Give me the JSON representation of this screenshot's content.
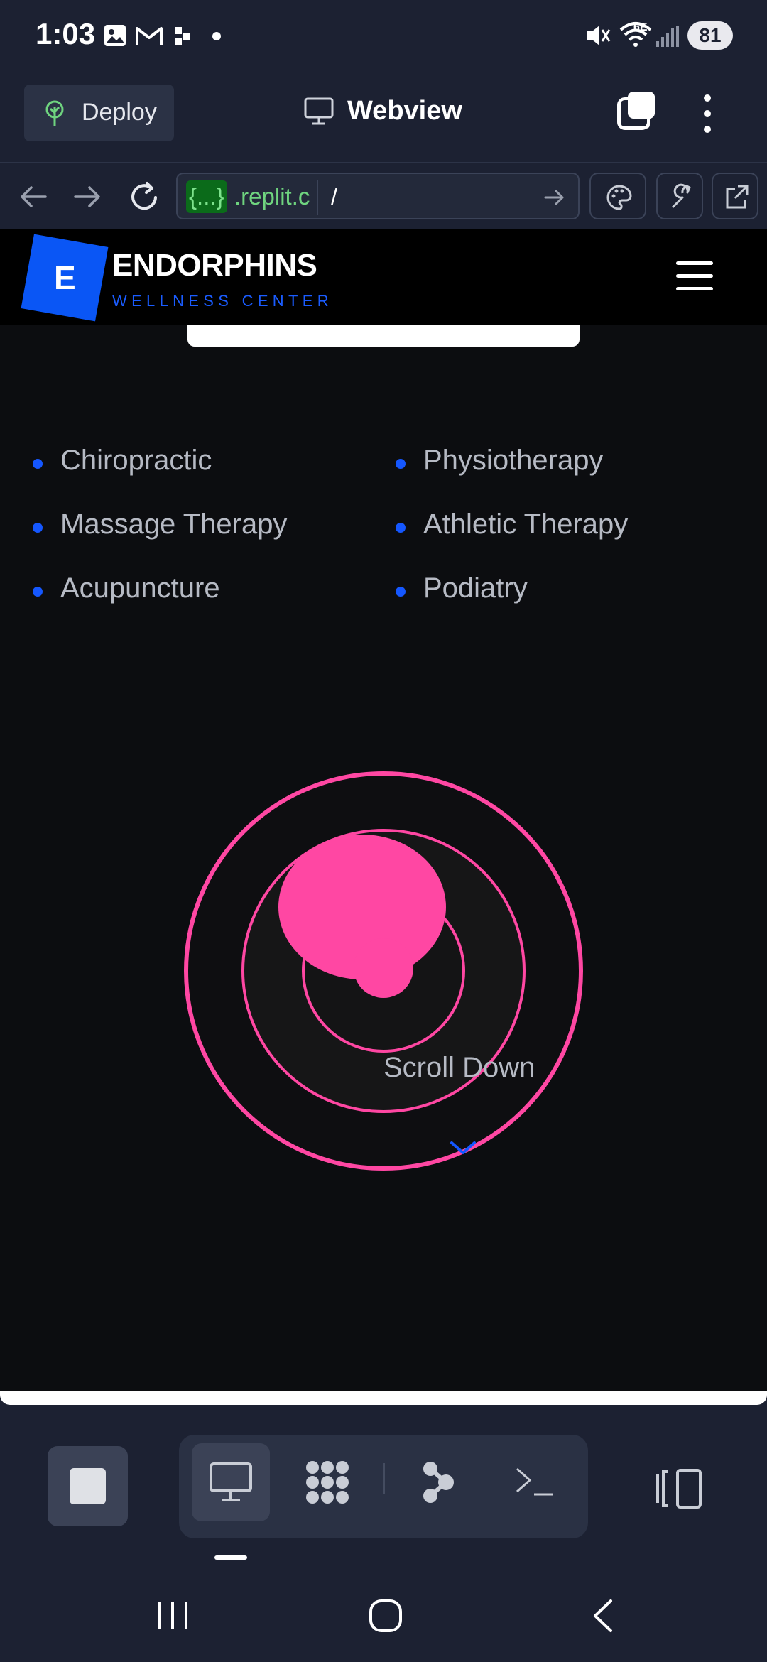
{
  "status_bar": {
    "time": "1:03",
    "battery": "81",
    "network": "6E"
  },
  "app_header": {
    "deploy_label": "Deploy",
    "title": "Webview"
  },
  "url_bar": {
    "host_tag": "{...}",
    "host_rest": ".replit.c",
    "path": "/"
  },
  "site": {
    "logo_letter": "E",
    "brand_name": "ENDORPHINS",
    "brand_sub": "WELLNESS CENTER",
    "services": [
      "Chiropractic",
      "Physiotherapy",
      "Massage Therapy",
      "Athletic Therapy",
      "Acupuncture",
      "Podiatry"
    ],
    "scroll_label": "Scroll Down"
  },
  "colors": {
    "app_bg": "#1c2132",
    "page_bg": "#0c0d10",
    "brand_blue": "#0a56f5",
    "accent_pink": "#ff47a3",
    "url_green": "#6fd47f"
  },
  "icons": {
    "deploy": "deploy-tree-icon",
    "webview": "monitor-icon",
    "tabs": "tabs-icon",
    "more": "kebab-icon",
    "back": "arrow-left-icon",
    "forward": "arrow-right-icon",
    "reload": "reload-icon",
    "go": "arrow-right-icon",
    "theme": "palette-icon",
    "devtools": "wrench-icon",
    "open_external": "external-link-icon",
    "stop": "stop-icon",
    "tools": [
      "monitor-icon",
      "workspace-icon",
      "graph-icon",
      "terminal-icon"
    ],
    "panes": "panes-icon",
    "nav": [
      "recents-icon",
      "home-icon",
      "back-icon"
    ]
  }
}
